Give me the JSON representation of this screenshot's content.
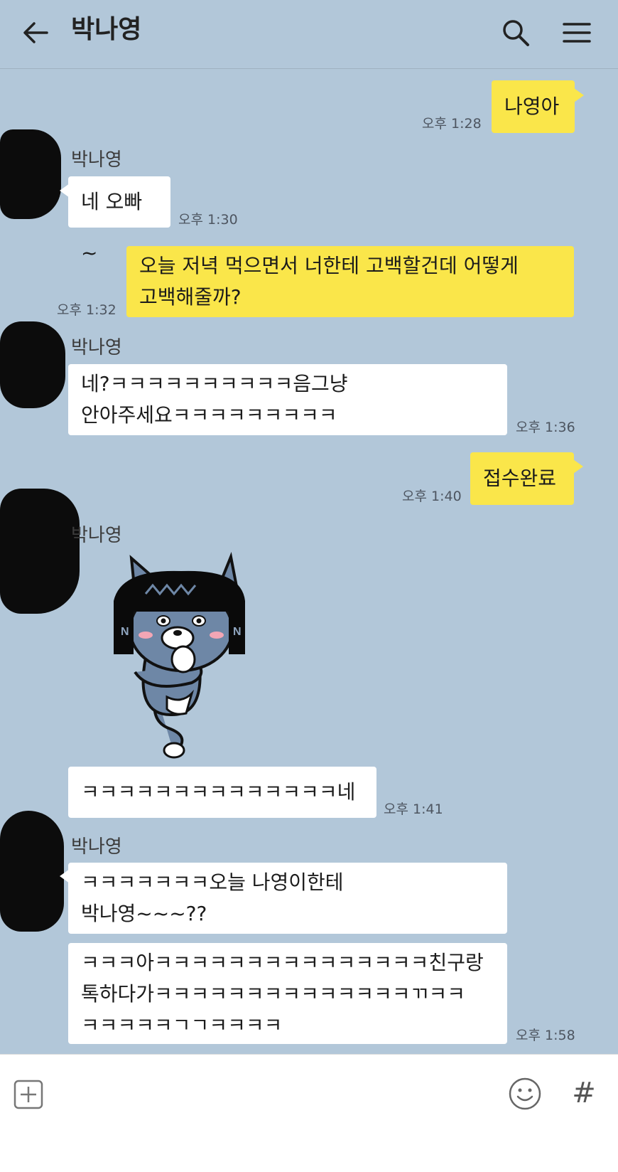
{
  "header": {
    "title": "박나영",
    "back_icon": "arrow-left-icon",
    "search_icon": "search-icon",
    "menu_icon": "menu-icon"
  },
  "messages": [
    {
      "direction": "out",
      "text": "나영아",
      "time": "오후 1:28"
    },
    {
      "direction": "in",
      "sender": "박나영",
      "text": "네 오빠~",
      "time": "오후 1:30"
    },
    {
      "direction": "out",
      "text": "오늘 저녁 먹으면서 너한테 고백할건데 어떻게\n고백해줄까?",
      "time": "오후 1:32"
    },
    {
      "direction": "in",
      "sender": "박나영",
      "text": "네?ㅋㅋㅋㅋㅋㅋㅋㅋㅋㅋ음그냥\n안아주세요ㅋㅋㅋㅋㅋㅋㅋㅋㅋ",
      "time": "오후 1:36"
    },
    {
      "direction": "out",
      "text": "접수완료",
      "time": "오후 1:40"
    },
    {
      "direction": "in",
      "sender": "박나영",
      "sticker": "crying-cat-sticker"
    },
    {
      "direction": "in",
      "text": "ㅋㅋㅋㅋㅋㅋㅋㅋㅋㅋㅋㅋㅋㅋ네",
      "time": "오후 1:41"
    },
    {
      "direction": "in",
      "sender": "박나영",
      "text": "ㅋㅋㅋㅋㅋㅋㅋ오늘 나영이한테\n박나영~~~??"
    },
    {
      "direction": "in",
      "text": "ㅋㅋㅋ아ㅋㅋㅋㅋㅋㅋㅋㅋㅋㅋㅋㅋㅋㅋㅋ친구랑\n톡하다가ㅋㅋㅋㅋㅋㅋㅋㅋㅋㅋㅋㅋㅋㅋㄲㅋㅋ\nㅋㅋㅋㅋㅋㄱㄱㅋㅋㅋㅋ",
      "time": "오후 1:58"
    }
  ],
  "input_bar": {
    "attach_icon": "plus-box-icon",
    "emoji_icon": "smiley-icon",
    "hash_label": "#"
  },
  "colors": {
    "background": "#b2c7d9",
    "outgoing_bubble": "#fae64a",
    "incoming_bubble": "#ffffff"
  }
}
